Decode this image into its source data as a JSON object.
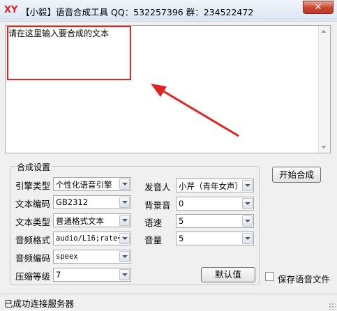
{
  "window": {
    "logo_text": "XY",
    "title": "【小毅】语音合成工具 QQ：532257396  群：234522472",
    "close_label": "✕"
  },
  "editor": {
    "text": "请在这里输入要合成的文本"
  },
  "settings": {
    "group_title": "合成设置",
    "engine_label": "引擎类型",
    "engine_value": "个性化语音引擎",
    "text_encoding_label": "文本编码",
    "text_encoding_value": "GB2312",
    "text_type_label": "文本类型",
    "text_type_value": "普通格式文本",
    "audio_format_label": "音频格式",
    "audio_format_value": "audio/L16;rate=",
    "audio_codec_label": "音频编码",
    "audio_codec_value": "speex",
    "compression_label": "压缩等级",
    "compression_value": "7",
    "speaker_label": "发音人",
    "speaker_value": "小芹（青年女声）",
    "bg_sound_label": "背景音",
    "bg_sound_value": "0",
    "speed_label": "语速",
    "speed_value": "5",
    "volume_label": "音量",
    "volume_value": "5",
    "default_button": "默认值"
  },
  "actions": {
    "start_button": "开始合成",
    "save_audio_label": "保存语音文件"
  },
  "status": {
    "text": "已成功连接服务器"
  },
  "colors": {
    "annotation": "#e02424"
  }
}
